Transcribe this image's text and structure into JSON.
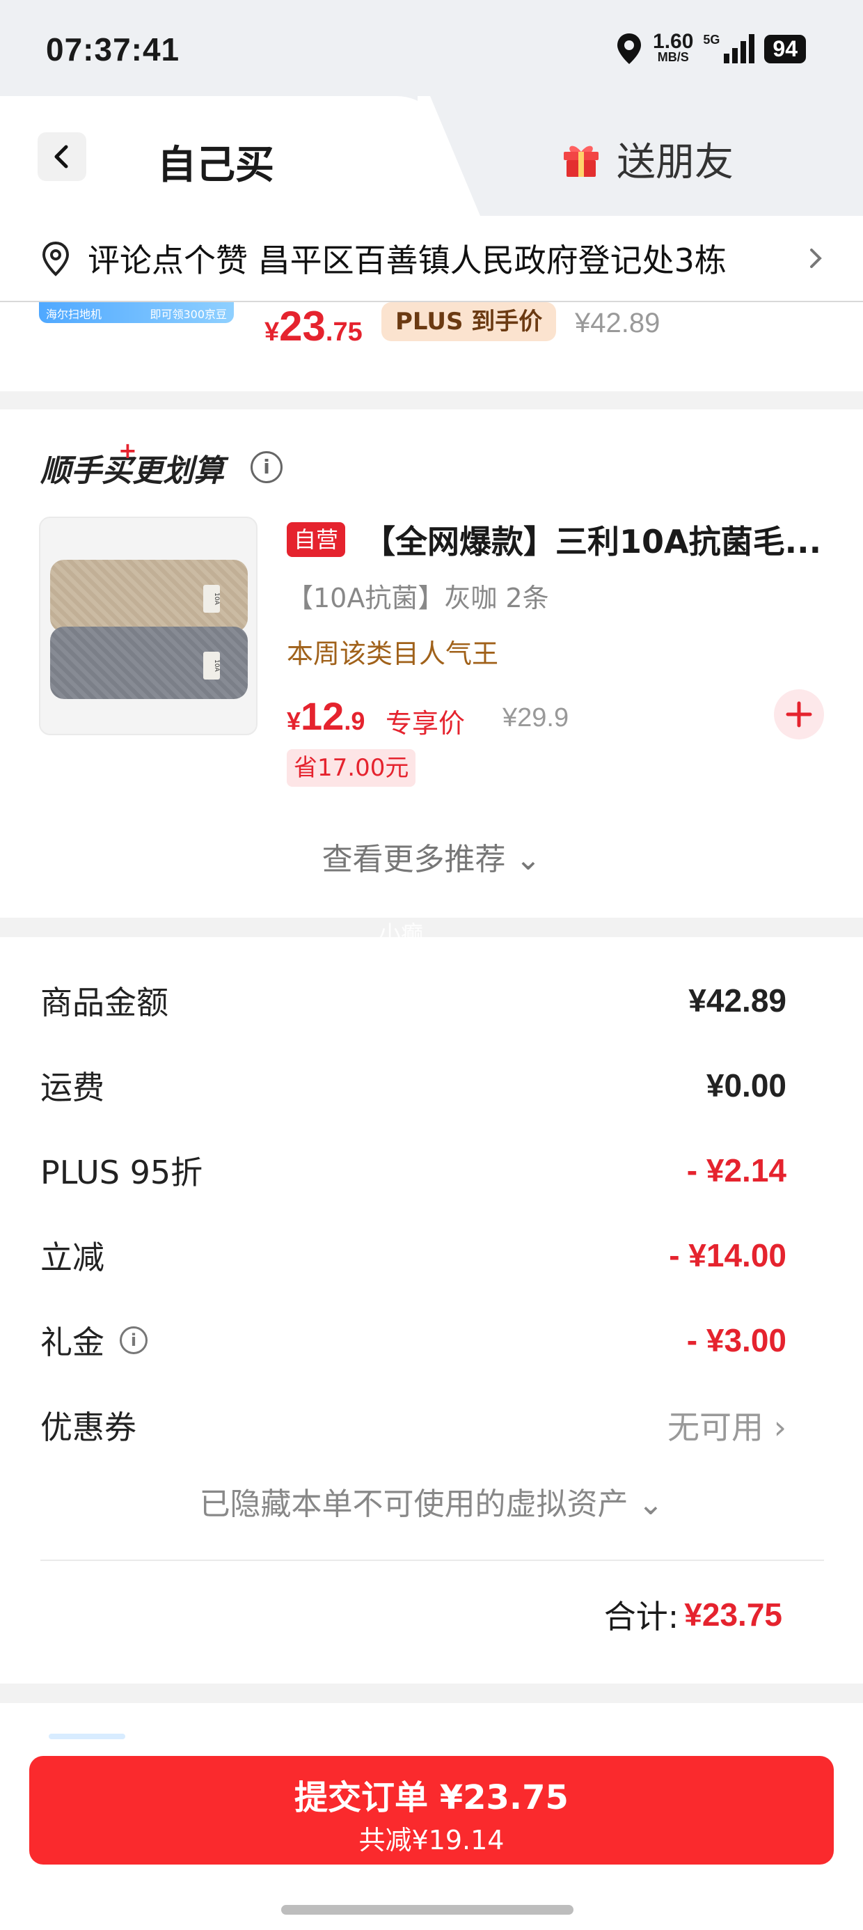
{
  "status_bar": {
    "time": "07:37:41",
    "net_speed": "1.60",
    "net_unit": "MB/S",
    "network": "5G",
    "battery": "94"
  },
  "tabs": {
    "self_buy": "自己买",
    "send_friend": "送朋友"
  },
  "address": {
    "text": "评论点个赞  昌平区百善镇人民政府登记处3栋"
  },
  "top_item": {
    "promo_left": "海尔扫地机",
    "promo_right": "即可领300京豆",
    "price_symbol": "¥",
    "price_int": "23",
    "price_dec": ".75",
    "plus_tag": "PLUS 到手价",
    "original_price": "¥42.89"
  },
  "recommend": {
    "title": "顺手买更划算",
    "title_plus": "+",
    "info_icon": "i",
    "product": {
      "image_label": "10A",
      "badge": "自营",
      "name": "【全网爆款】三利10A抗菌毛...",
      "spec": "【10A抗菌】灰咖 2条",
      "hot": "本周该类目人气王",
      "price_symbol": "¥",
      "price_int": "12",
      "price_dec": ".9",
      "price_tag": "专享价",
      "original_price": "¥29.9",
      "save_tag": "省17.00元"
    },
    "more": "查看更多推荐 ⌄"
  },
  "watermark": "小癫",
  "summary": {
    "rows": [
      {
        "label": "商品金额",
        "value": "¥42.89"
      },
      {
        "label": "运费",
        "value": "¥0.00"
      },
      {
        "label": "PLUS 95折",
        "value": "- ¥2.14"
      },
      {
        "label": "立减",
        "value": "- ¥14.00"
      },
      {
        "label": "礼金",
        "value": "- ¥3.00"
      },
      {
        "label": "优惠券",
        "value": "无可用 ›"
      }
    ],
    "info_icon": "i",
    "hidden_assets": "已隐藏本单不可使用的虚拟资产 ⌄",
    "total_label": "合计:",
    "total_value": "¥23.75"
  },
  "submit": {
    "main": "提交订单 ¥23.75",
    "sub": "共减¥19.14"
  },
  "colors": {
    "accent_red": "#e5232e",
    "submit_red": "#fa2a2d",
    "plus_tag_bg": "#fbe3cf",
    "hot_text": "#a0611a"
  }
}
